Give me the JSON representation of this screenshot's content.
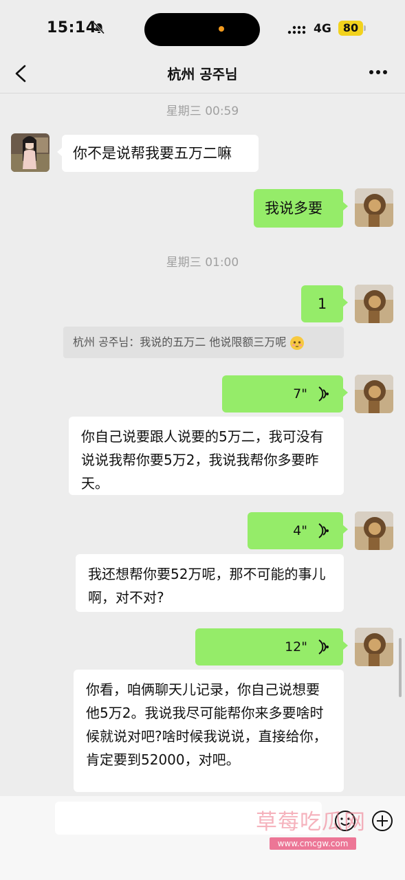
{
  "status_bar": {
    "time": "15:14",
    "network": "4G",
    "battery": "80"
  },
  "header": {
    "title": "杭州 공주님"
  },
  "messages": {
    "time1": "星期三 00:59",
    "m1": "你不是说帮我要五万二嘛",
    "m2": "我说多要",
    "time2": "星期三 01:00",
    "m3": "1",
    "quote": "杭州 공주님：我说的五万二 他说限额三万呢",
    "v1_duration": "7\"",
    "v1_text": "你自己说要跟人说要的5万二，我可没有说说我帮你要5万2，我说我帮你多要昨天。",
    "v2_duration": "4\"",
    "v2_text": "我还想帮你要52万呢，那不可能的事儿啊，对不对?",
    "v3_duration": "12\"",
    "v3_text": "你看，咱俩聊天儿记录，你自己说想要他5万2。我说我尽可能帮你来多要啥时候就说对吧?啥时候我说说，直接给你，肯定要到52000，对吧。"
  },
  "watermark": {
    "text": "草莓吃瓜网",
    "url": "www.cmcgw.com"
  },
  "icons": {
    "mute": "bell-slash-icon",
    "back": "chevron-left-icon",
    "more": "ellipsis-icon",
    "voice": "voice-wave-icon",
    "emoji": "smiley-icon",
    "plus": "plus-icon"
  },
  "colors": {
    "sent_bubble": "#95ec69",
    "received_bubble": "#ffffff",
    "background": "#ededed",
    "battery": "#f2d21d"
  }
}
